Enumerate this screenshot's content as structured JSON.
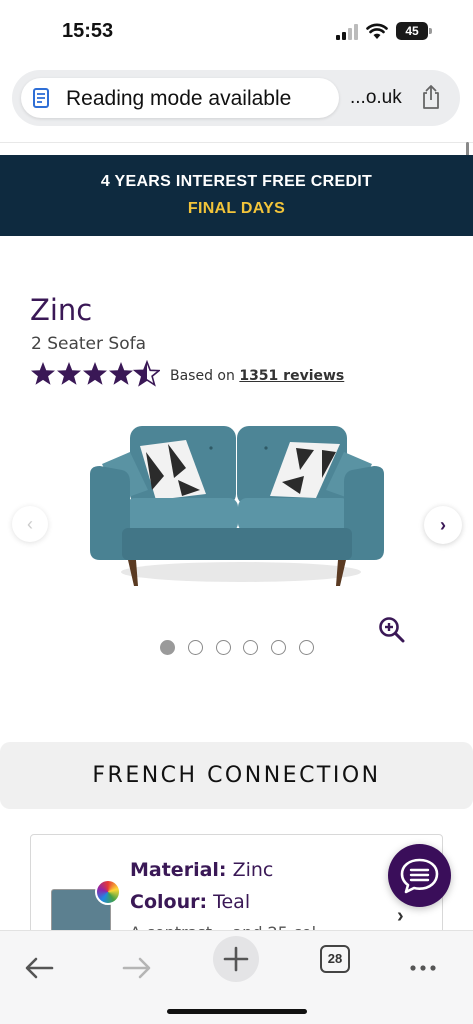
{
  "status_bar": {
    "time": "15:53",
    "battery": "45"
  },
  "browser": {
    "reading_mode": "Reading mode available",
    "url": "...o.uk",
    "tab_count": "28"
  },
  "promo": {
    "line1": "4 YEARS INTEREST FREE CREDIT",
    "line2": "FINAL DAYS",
    "bg_color": "#0e2a3f",
    "accent_color": "#f2c43a"
  },
  "product": {
    "name": "Zinc",
    "type": "2 Seater Sofa",
    "rating": 4.5,
    "rating_max": 5,
    "reviews_prefix": "Based on",
    "reviews_link": "1351 reviews"
  },
  "carousel": {
    "total_images": 6,
    "active_index": 0
  },
  "brand": {
    "name": "FRENCH CONNECTION"
  },
  "material_card": {
    "material_key": "Material:",
    "material_value": "Zinc",
    "colour_key": "Colour:",
    "colour_value": "Teal",
    "extra_partial": "A contrast... and 25 col..."
  },
  "icons": {
    "reader": "reader-icon",
    "share": "share-icon",
    "zoom": "zoom-in-icon",
    "chat": "chat-bubble-icon",
    "back": "back-arrow-icon",
    "forward": "forward-arrow-icon",
    "new_tab": "plus-icon",
    "more": "more-dots-icon"
  },
  "colors": {
    "brand_purple": "#3a1856",
    "chat_purple": "#3a0e5a"
  }
}
